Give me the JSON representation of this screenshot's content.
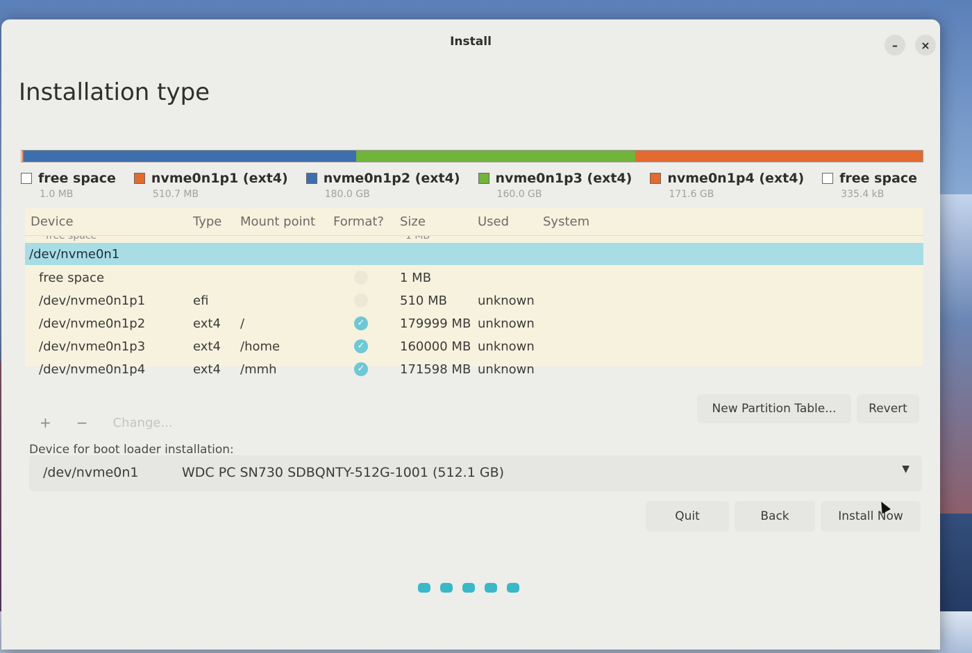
{
  "window": {
    "title": "Install",
    "minimize_label": "–",
    "close_label": "×",
    "page_title": "Installation type"
  },
  "partition_bar": {
    "segments": [
      {
        "name": "free space",
        "color": "#ffffff",
        "fraction": 0.001
      },
      {
        "name": "nvme0n1p1 (ext4)",
        "color": "#e36b2f",
        "fraction": 0.001
      },
      {
        "name": "nvme0n1p2 (ext4)",
        "color": "#3d6fae",
        "fraction": 0.369
      },
      {
        "name": "nvme0n1p3 (ext4)",
        "color": "#70b43c",
        "fraction": 0.31
      },
      {
        "name": "nvme0n1p4 (ext4)",
        "color": "#e36b2f",
        "fraction": 0.319
      }
    ]
  },
  "legend": [
    {
      "label": "free space",
      "size": "1.0 MB",
      "color": "#ffffff"
    },
    {
      "label": "nvme0n1p1 (ext4)",
      "size": "510.7 MB",
      "color": "#e36b2f"
    },
    {
      "label": "nvme0n1p2 (ext4)",
      "size": "180.0 GB",
      "color": "#3d6fae"
    },
    {
      "label": "nvme0n1p3 (ext4)",
      "size": "160.0 GB",
      "color": "#70b43c"
    },
    {
      "label": "nvme0n1p4 (ext4)",
      "size": "171.6 GB",
      "color": "#e36b2f"
    },
    {
      "label": "free space",
      "size": "335.4 kB",
      "color": "#ffffff"
    }
  ],
  "table": {
    "headers": {
      "device": "Device",
      "type": "Type",
      "mount": "Mount point",
      "format": "Format?",
      "size": "Size",
      "used": "Used",
      "system": "System"
    },
    "ghost_text": "free space",
    "ghost_size": "1 MB",
    "selected_device": "/dev/nvme0n1",
    "rows": [
      {
        "device": "free space",
        "type": "",
        "mount": "",
        "format": false,
        "size": "1 MB",
        "used": ""
      },
      {
        "device": "/dev/nvme0n1p1",
        "type": "efi",
        "mount": "",
        "format": false,
        "size": "510 MB",
        "used": "unknown"
      },
      {
        "device": "/dev/nvme0n1p2",
        "type": "ext4",
        "mount": "/",
        "format": true,
        "size": "179999 MB",
        "used": "unknown"
      },
      {
        "device": "/dev/nvme0n1p3",
        "type": "ext4",
        "mount": "/home",
        "format": true,
        "size": "160000 MB",
        "used": "unknown"
      },
      {
        "device": "/dev/nvme0n1p4",
        "type": "ext4",
        "mount": "/mmh",
        "format": true,
        "size": "171598 MB",
        "used": "unknown"
      }
    ]
  },
  "tools": {
    "add": "+",
    "remove": "−",
    "change": "Change...",
    "new_table": "New Partition Table...",
    "revert": "Revert"
  },
  "bootloader": {
    "label": "Device for boot loader installation:",
    "device": "/dev/nvme0n1",
    "model": "WDC PC SN730 SDBQNTY-512G-1001 (512.1 GB)"
  },
  "actions": {
    "quit": "Quit",
    "back": "Back",
    "install": "Install Now"
  },
  "progress": {
    "steps": 5
  }
}
